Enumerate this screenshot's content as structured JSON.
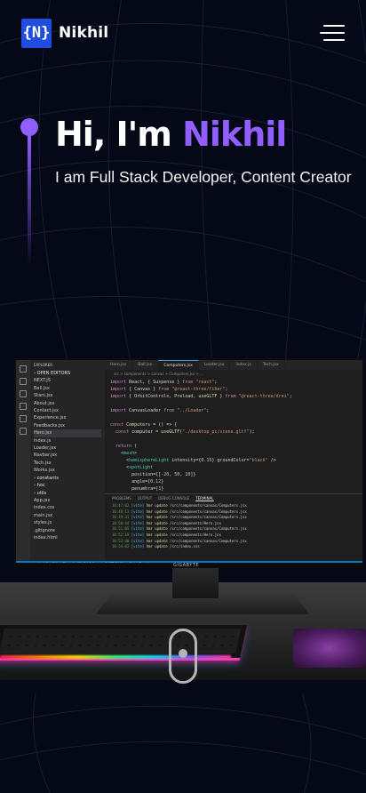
{
  "navbar": {
    "logo_text": "{N}",
    "brand": "Nikhil",
    "menu_icon": "hamburger-menu-icon"
  },
  "hero": {
    "greeting": "Hi, I'm ",
    "name": "Nikhil",
    "subtitle": "I am Full Stack Developer, Content Creator",
    "accent_color": "#915eff"
  },
  "scene": {
    "monitor_brand": "GIGABYTE",
    "explorer_title": "EXPLORER",
    "explorer_items": [
      "OPEN EDITORS",
      "NEXT.JS",
      "Ball.jsx",
      "Stars.jsx",
      "About.jsx",
      "Contact.jsx",
      "Experience.jsx",
      "Feedbacks.jsx",
      "Hero.jsx",
      "index.js",
      "Loader.jsx",
      "Navbar.jsx",
      "Tech.jsx",
      "Works.jsx",
      "constants",
      "hoc",
      "utils",
      "App.jsx",
      "index.css",
      "main.jsx",
      "styles.js",
      ".gitignore",
      "index.html"
    ],
    "tabs": [
      "Hero.jsx",
      "Ball.jsx",
      "Computers.jsx",
      "Loader.jsx",
      "index.js",
      "Tech.jsx"
    ],
    "breadcrumb": "src > components > canvas > Computers.jsx > ...",
    "code_lines": [
      "import React, { Suspense } from \"react\";",
      "import { Canvas } from \"@react-three/fiber\";",
      "import { OrbitControls, Preload, useGLTF } from \"@react-three/drei\";",
      "",
      "import CanvasLoader from \"../Loader\";",
      "",
      "const Computers = () => {",
      "  const computer = useGLTF(\"./desktop_pc/scene.gltf\");",
      "",
      "  return (",
      "    <mesh>",
      "      <hemisphereLight intensity={0.15} groundColor=\"black\" />",
      "      <spotLight",
      "        position={[-20, 50, 10]}",
      "        angle={0.12}",
      "        penumbra={1}"
    ],
    "terminal_tabs": [
      "PROBLEMS",
      "OUTPUT",
      "DEBUG CONSOLE",
      "TERMINAL"
    ],
    "terminal_lines": [
      "10:47:02 [vite] hmr update /src/components/canvas/Computers.jsx",
      "10:48:13 [vite] hmr update /src/components/canvas/Computers.jsx",
      "10:49:31 [vite] hmr update /src/components/canvas/Computers.jsx",
      "10:50:44 [vite] hmr update /src/components/Hero.jsx",
      "10:51:05 [vite] hmr update /src/components/canvas/Computers.jsx",
      "10:52:19 [vite] hmr update /src/components/Hero.jsx",
      "10:53:40 [vite] hmr update /src/components/canvas/Computers.jsx",
      "10:54:02 [vite] hmr update /src/index.css"
    ],
    "status_text": "main  ⊗ 0 △ 0    Live Share        Ln 18, Col 1   Spaces: 2   UTF-8   LF   JavaScript React",
    "scroll_indicator": "mouse-scroll-icon"
  }
}
